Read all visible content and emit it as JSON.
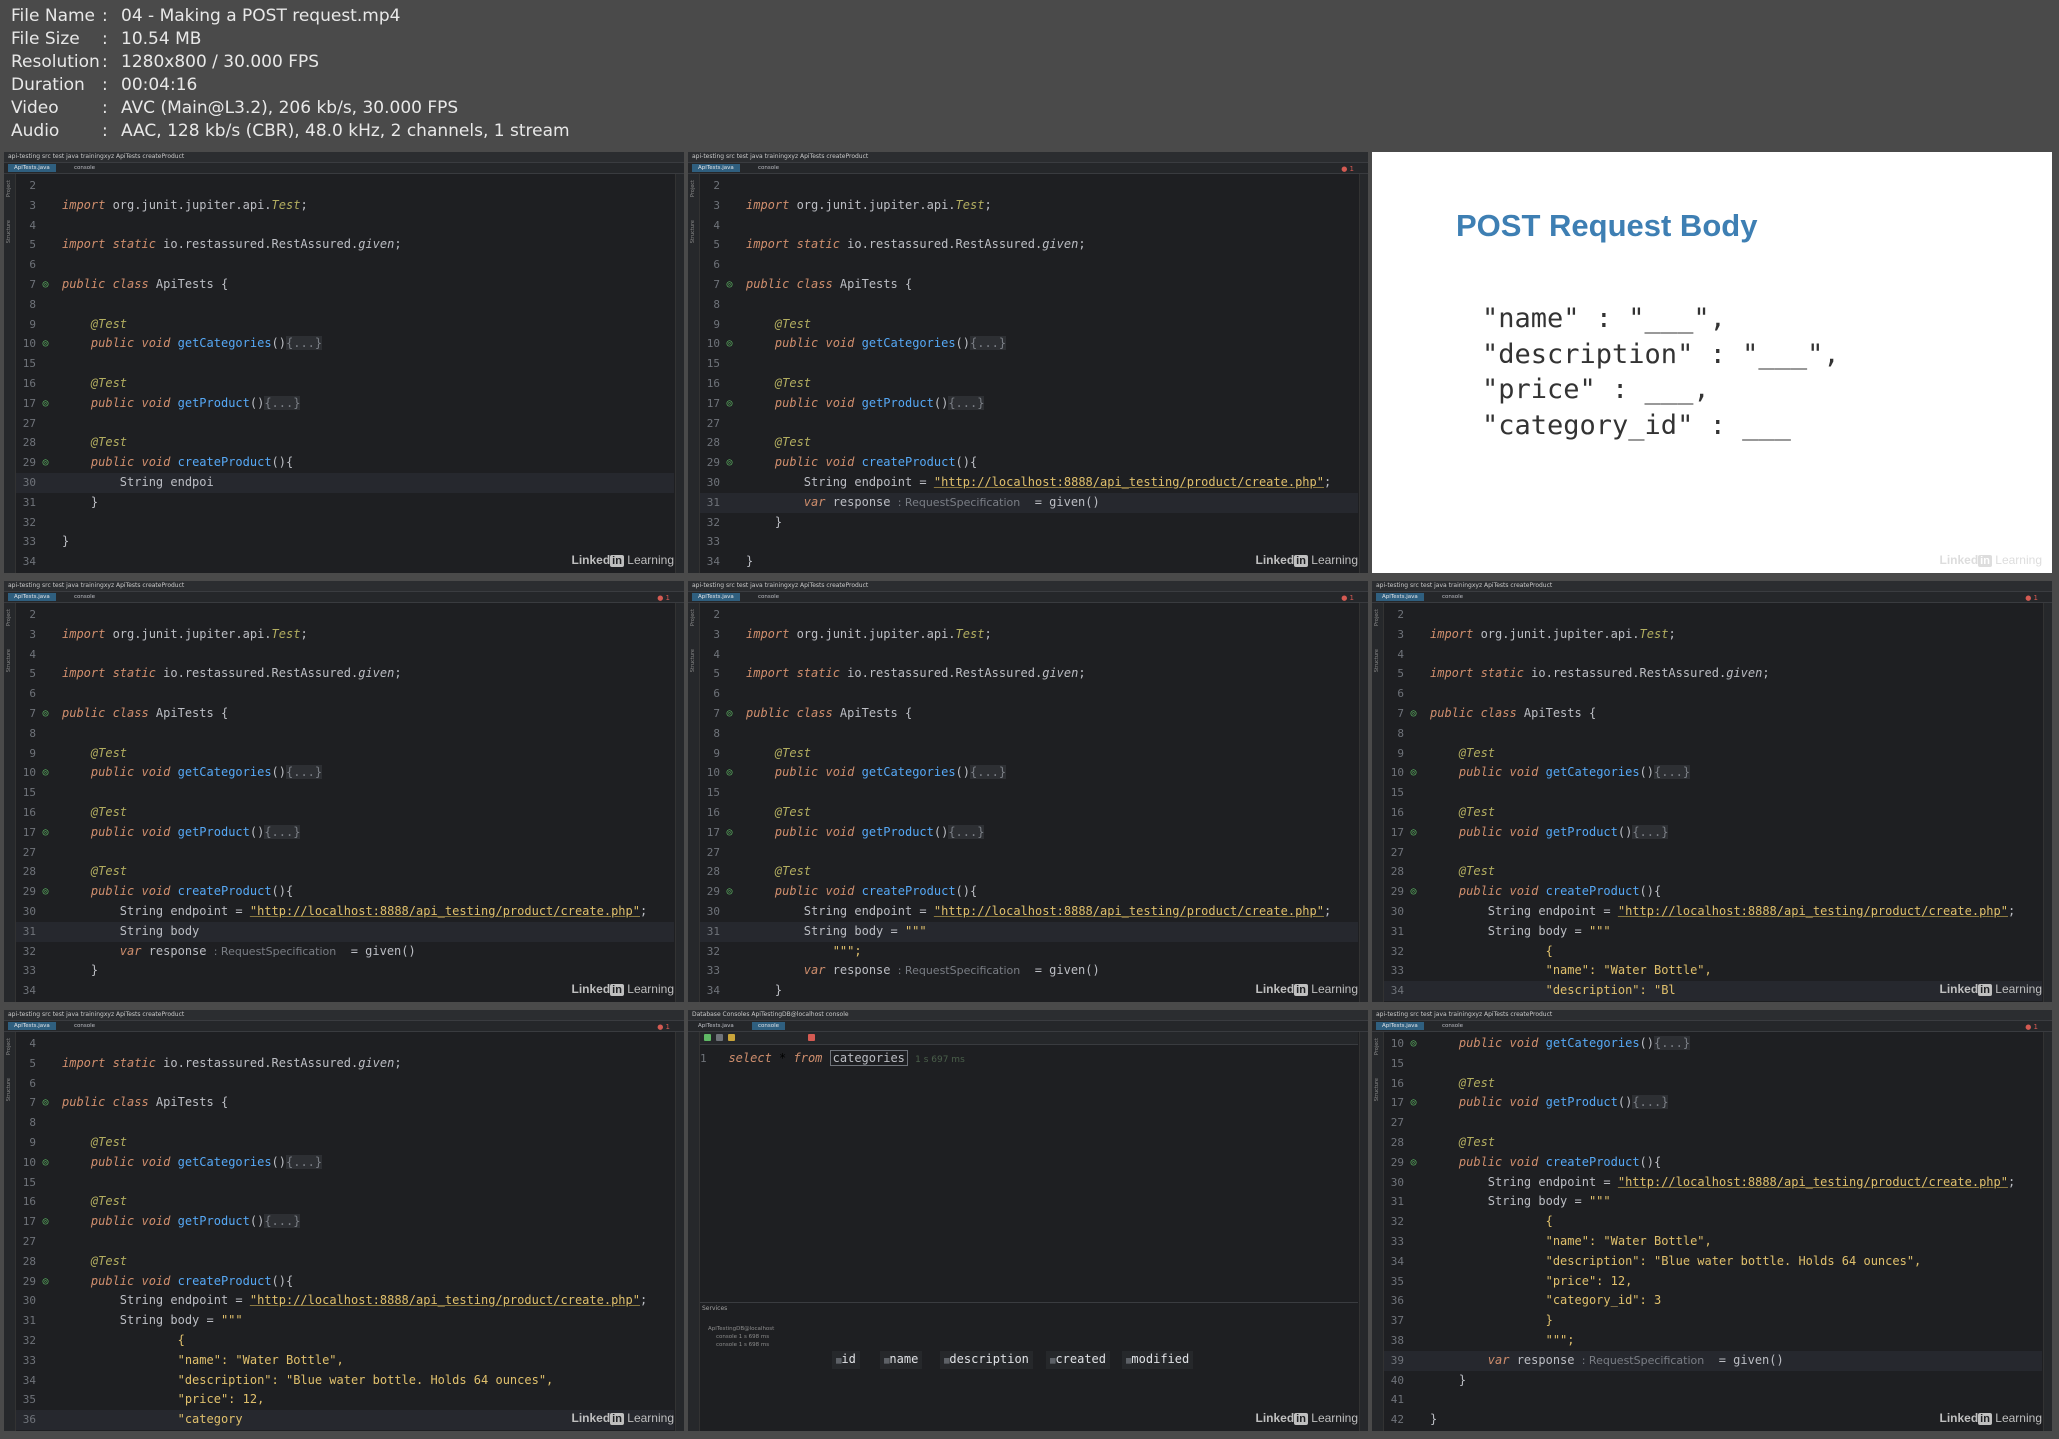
{
  "info": [
    {
      "key": "File Name",
      "value": "04 - Making a POST request.mp4"
    },
    {
      "key": "File Size",
      "value": "10.54 MB"
    },
    {
      "key": "Resolution",
      "value": "1280x800 / 30.000 FPS"
    },
    {
      "key": "Duration",
      "value": "00:04:16"
    },
    {
      "key": "Video",
      "value": "AVC (Main@L3.2), 206 kb/s, 30.000 FPS"
    },
    {
      "key": "Audio",
      "value": "AAC, 128 kb/s (CBR), 48.0 kHz, 2 channels, 1 stream"
    }
  ],
  "ide": {
    "breadcrumbs": "api-testing  src  test  java  trainingxyz  ApiTests  createProduct",
    "tab_file": "ApiTests.java",
    "tab_console": "console",
    "strip_project": "Project",
    "strip_structure": "Structure"
  },
  "branding": {
    "linkedin_box": "in",
    "linkedin_prefix": "Linked",
    "learning": "Learning"
  },
  "slide": {
    "title": "POST Request Body",
    "lines": [
      "\"name\" : \"___\",",
      "\"description\" : \"___\",",
      "\"price\" : ___,",
      "\"category_id\" : ___"
    ]
  },
  "db": {
    "tabs": "Database Consoles   ApiTestingDB@localhost   console",
    "query_select": "select",
    "query_star": " * ",
    "query_from": "from",
    "query_table": "categories",
    "query_time": "1 s 697 ms",
    "services_label": "Services",
    "tree": [
      "ApiTestingDB@localhost",
      "console  1 s 698 ms",
      "console  1 s 698 ms"
    ],
    "columns": [
      "id",
      "name",
      "description",
      "created",
      "modified"
    ]
  }
}
